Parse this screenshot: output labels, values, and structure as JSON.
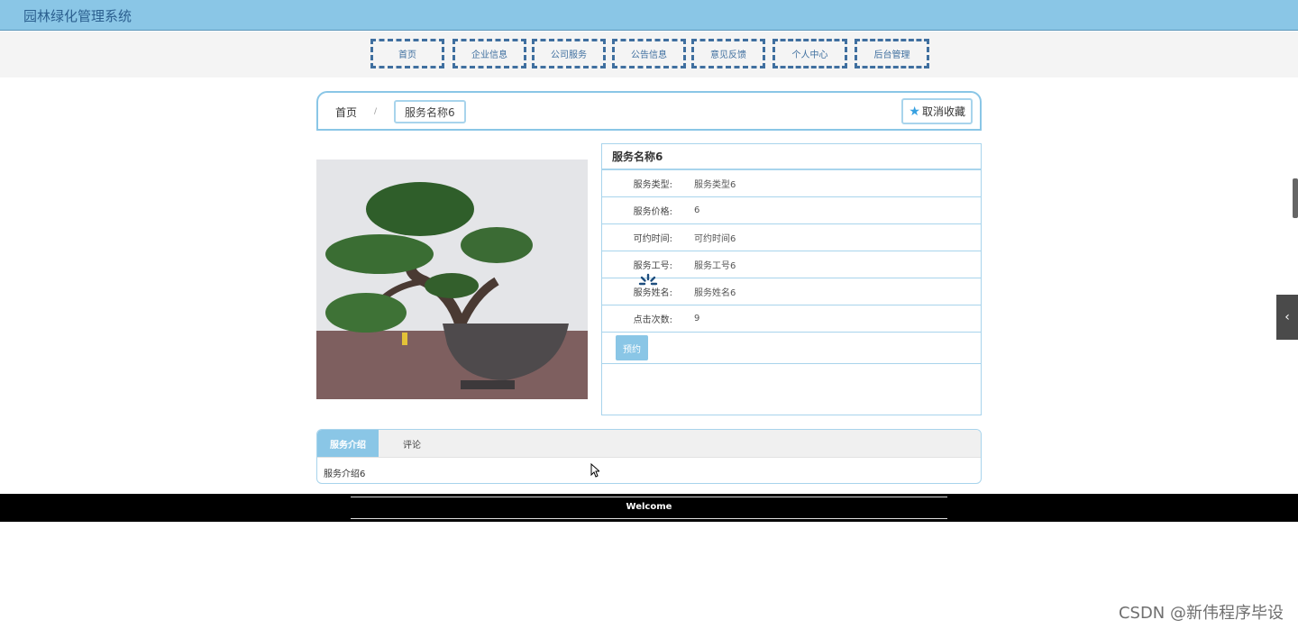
{
  "app": {
    "title": "园林绿化管理系统"
  },
  "nav": [
    "首页",
    "企业信息",
    "公司服务",
    "公告信息",
    "意见反馈",
    "个人中心",
    "后台管理"
  ],
  "breadcrumb": {
    "home": "首页",
    "separator": "/",
    "current": "服务名称6"
  },
  "favorite": {
    "label": "取消收藏",
    "icon": "star-icon"
  },
  "detail": {
    "title": "服务名称6",
    "rows": [
      {
        "label": "服务类型:",
        "value": "服务类型6"
      },
      {
        "label": "服务价格:",
        "value": "6"
      },
      {
        "label": "可约时间:",
        "value": "可约时间6"
      },
      {
        "label": "服务工号:",
        "value": "服务工号6"
      },
      {
        "label": "服务姓名:",
        "value": "服务姓名6"
      },
      {
        "label": "点击次数:",
        "value": "9"
      }
    ],
    "book_label": "预约"
  },
  "tabs": {
    "items": [
      {
        "label": "服务介绍"
      },
      {
        "label": "评论"
      }
    ],
    "content": "服务介绍6"
  },
  "footer": {
    "text": "Welcome"
  },
  "watermark": "CSDN @新伟程序毕设",
  "colors": {
    "accent": "#8ac6e6",
    "nav_border": "#3f6f9f",
    "footer_bg": "#000000"
  }
}
